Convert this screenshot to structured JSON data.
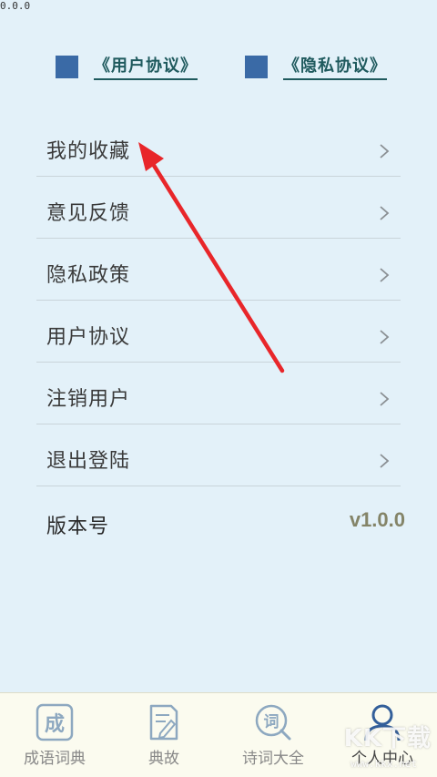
{
  "top_left_version": "0.0.0",
  "agreements": {
    "user_agreement": "《用户协议》",
    "privacy_agreement": "《隐私协议》"
  },
  "menu": [
    {
      "label": "我的收藏"
    },
    {
      "label": "意见反馈"
    },
    {
      "label": "隐私政策"
    },
    {
      "label": "用户协议"
    },
    {
      "label": "注销用户"
    },
    {
      "label": "退出登陆"
    }
  ],
  "version": {
    "label": "版本号",
    "value": "v1.0.0"
  },
  "tabs": [
    {
      "label": "成语词典",
      "icon": "idiom-dictionary-icon"
    },
    {
      "label": "典故",
      "icon": "allusion-icon"
    },
    {
      "label": "诗词大全",
      "icon": "poetry-search-icon"
    },
    {
      "label": "个人中心",
      "icon": "user-profile-icon"
    }
  ],
  "watermark": {
    "text": "KK下载",
    "url": "www.kkx.net"
  },
  "colors": {
    "background": "#e3f1f9",
    "checkbox": "#3a6aa6",
    "link": "#1f5a5e",
    "arrow": "#e8262a",
    "version": "#848468"
  }
}
